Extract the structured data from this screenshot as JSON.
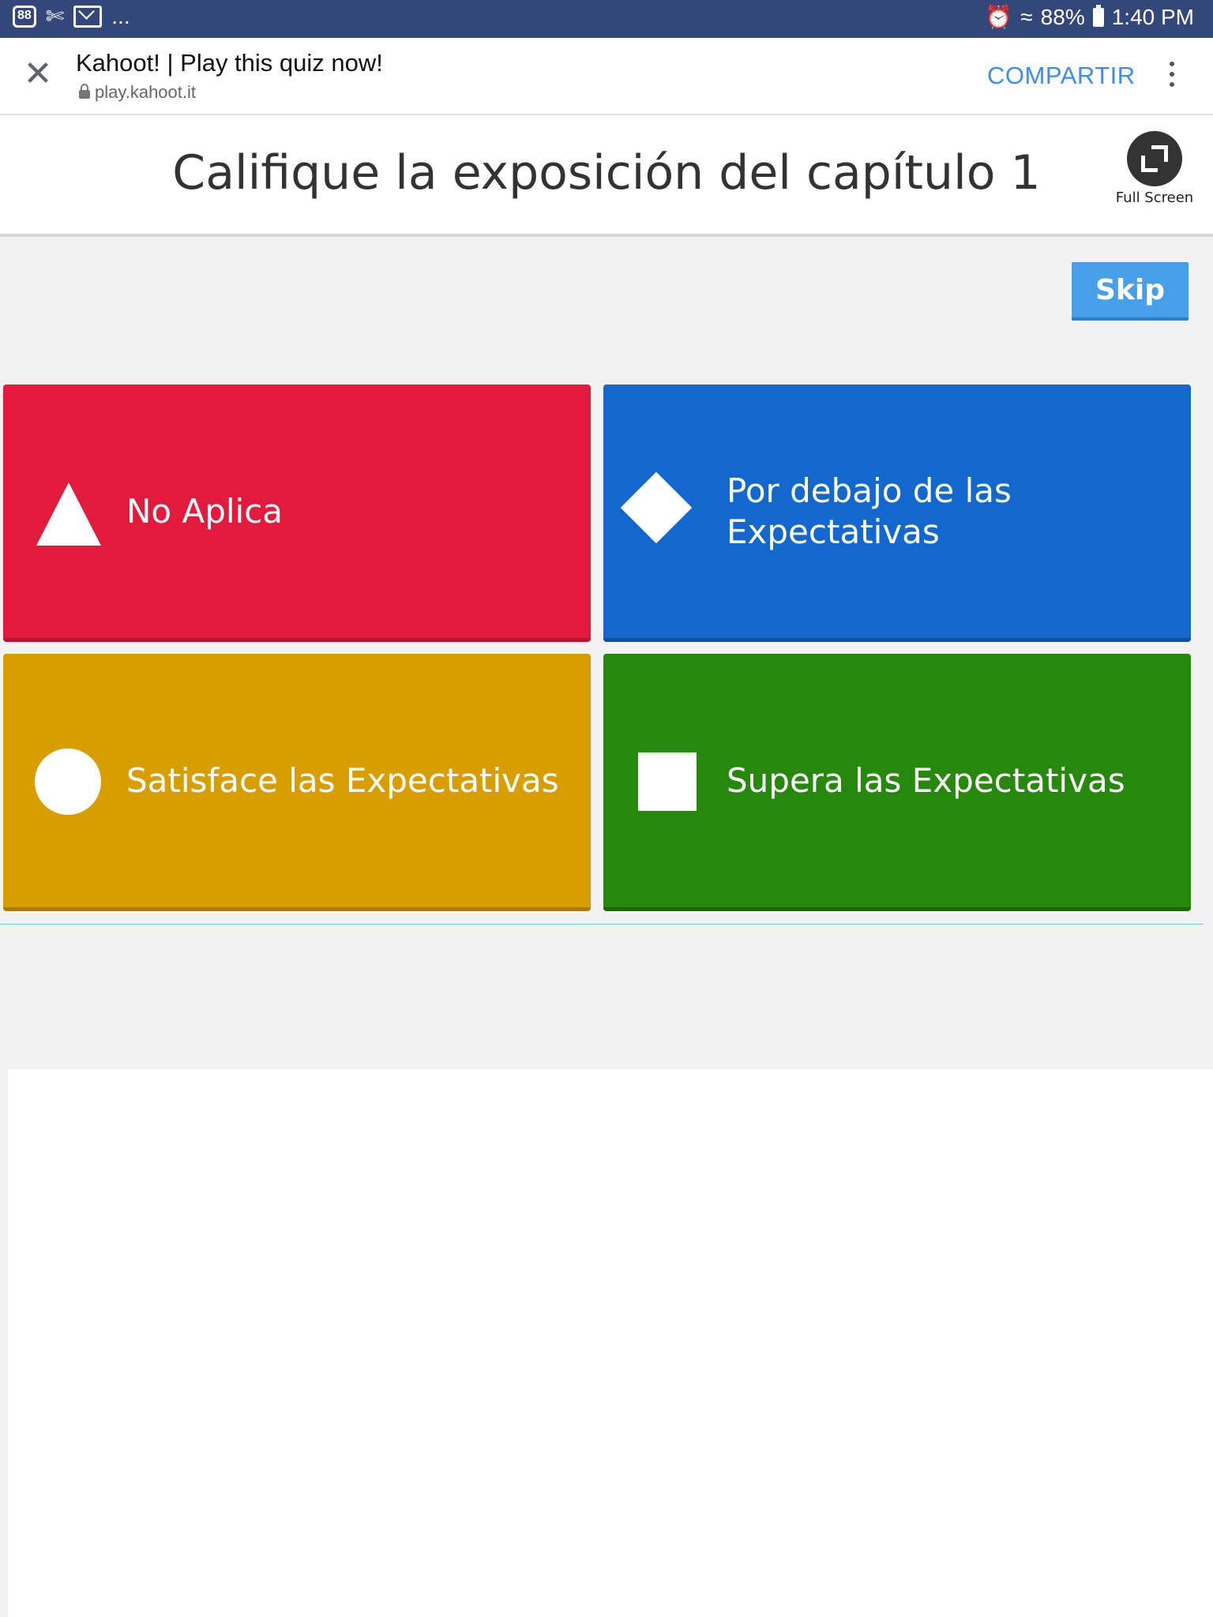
{
  "status_bar": {
    "notification_badge": "88",
    "overflow": "...",
    "battery_percent": "88%",
    "time": "1:40 PM"
  },
  "browser": {
    "title": "Kahoot! | Play this quiz now!",
    "url": "play.kahoot.it",
    "share_label": "COMPARTIR"
  },
  "question": {
    "title": "Califique la exposición del capítulo 1",
    "fullscreen_label": "Full Screen"
  },
  "skip_label": "Skip",
  "answers": [
    {
      "label": "No Aplica",
      "shape": "triangle-icon",
      "color": "#e21b3c"
    },
    {
      "label": "Por debajo de las Expectativas",
      "shape": "diamond-icon",
      "color": "#1368ce"
    },
    {
      "label": "Satisface las Expectativas",
      "shape": "circle-icon",
      "color": "#d89e00"
    },
    {
      "label": "Supera las Expectativas",
      "shape": "square-icon",
      "color": "#26890c"
    }
  ]
}
